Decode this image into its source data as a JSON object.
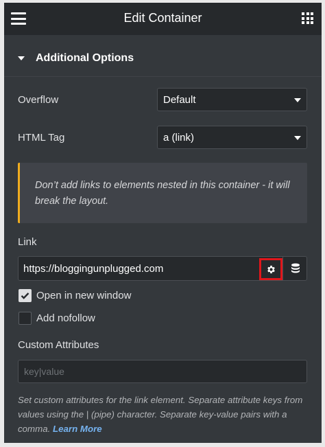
{
  "header": {
    "title": "Edit Container"
  },
  "section": {
    "title": "Additional Options"
  },
  "overflow": {
    "label": "Overflow",
    "value": "Default"
  },
  "html_tag": {
    "label": "HTML Tag",
    "value": "a (link)"
  },
  "notice": {
    "text": "Don’t add links to elements nested in this container - it will break the layout."
  },
  "link": {
    "label": "Link",
    "value": "https://bloggingunplugged.com"
  },
  "options": {
    "open_new_window": {
      "label": "Open in new window",
      "checked": true
    },
    "nofollow": {
      "label": "Add nofollow",
      "checked": false
    }
  },
  "custom_attributes": {
    "label": "Custom Attributes",
    "placeholder": "key|value",
    "help": "Set custom attributes for the link element. Separate attribute keys from values using the | (pipe) character. Separate key-value pairs with a comma.",
    "learn_more": "Learn More"
  },
  "colors": {
    "panel_bg": "#34383c",
    "topbar_bg": "#26292c",
    "notice_accent": "#f0ad1f",
    "highlight_box": "#e0161b",
    "link_color": "#76b3f0"
  },
  "icons": [
    "hamburger-icon",
    "apps-grid-icon",
    "caret-down-icon",
    "gear-icon",
    "database-icon",
    "check-icon"
  ]
}
